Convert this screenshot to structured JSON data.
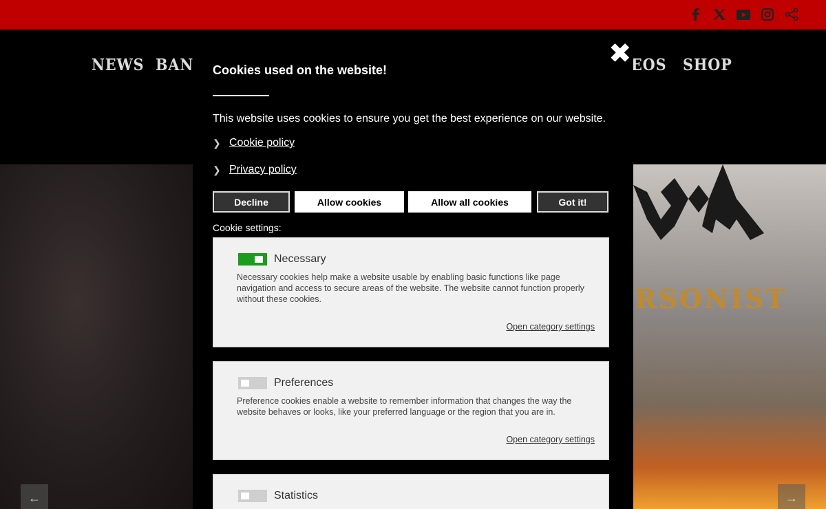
{
  "social": {
    "icons": [
      "facebook-icon",
      "x-icon",
      "youtube-icon",
      "instagram-icon",
      "share-icon"
    ]
  },
  "nav": {
    "items": [
      "News",
      "Band",
      "eos",
      "Shop"
    ]
  },
  "hero": {
    "logo_text": "RSONIST"
  },
  "cookie": {
    "title": "Cookies used on the website!",
    "description": "This website uses cookies to ensure you get the best experience on our website.",
    "links": [
      "Cookie policy",
      "Privacy policy"
    ],
    "buttons": {
      "decline": "Decline",
      "allow": "Allow cookies",
      "allow_all": "Allow all cookies",
      "got_it": "Got it!"
    },
    "settings_label": "Cookie settings:",
    "categories": [
      {
        "title": "Necessary",
        "enabled": true,
        "text": "Necessary cookies help make a website usable by enabling basic functions like page navigation and access to secure areas of the website. The website cannot function properly without these cookies.",
        "link": "Open category settings"
      },
      {
        "title": "Preferences",
        "enabled": false,
        "text": "Preference cookies enable a website to remember information that changes the way the website behaves or looks, like your preferred language or the region that you are in.",
        "link": "Open category settings"
      },
      {
        "title": "Statistics",
        "enabled": false
      }
    ],
    "close_symbol": "✖"
  },
  "colors": {
    "topbar": "#c00000",
    "toggle_on": "#1c9c1c",
    "toggle_off": "#cfcfcf"
  }
}
